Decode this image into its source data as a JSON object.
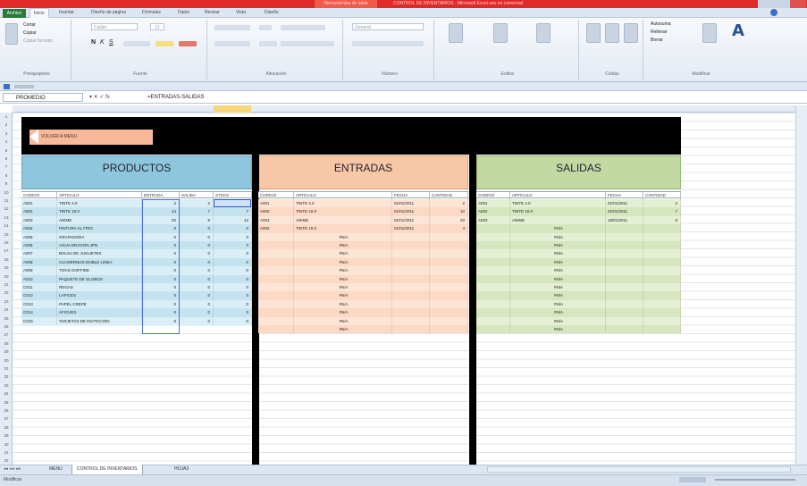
{
  "title_bar": {
    "tools_label": "Herramientas de tabla",
    "document_title": "CONTROL DE INVENTARIOS - Microsoft Excel uso no comercial"
  },
  "ribbon": {
    "tabs": [
      "Archivo",
      "Inicio",
      "Insertar",
      "Diseño de página",
      "Fórmulas",
      "Datos",
      "Revisar",
      "Vista",
      "Diseño"
    ],
    "groups": [
      "Portapapeles",
      "Fuente",
      "Alineación",
      "Número",
      "Estilos",
      "Celdas",
      "Modificar"
    ],
    "clipboard_items": [
      "Cortar",
      "Copiar",
      "Copiar formato"
    ],
    "font_name": "Calibri",
    "font_size": "11",
    "number_format": "General",
    "edit_items": [
      "Autosuma",
      "Rellenar",
      "Borrar"
    ]
  },
  "formula_bar": {
    "name_box": "PROMEDIO",
    "formula": "=ENTRADAS-SALIDAS"
  },
  "banner": {
    "back_label": "VOLVER A MENU"
  },
  "sections": {
    "productos": "PRODUCTOS",
    "entradas": "ENTRADAS",
    "salidas": "SALIDAS"
  },
  "productos": {
    "headers": [
      "CODIGO",
      "ARTICULO",
      "ENTRADA",
      "SALIDA",
      "STOCK"
    ],
    "rows": [
      [
        "A001",
        "TINTE 4.0",
        "2",
        "2",
        "=ENTRADAS-SALIDAS"
      ],
      [
        "A002",
        "TINTE 10.0",
        "14",
        "7",
        "7"
      ],
      [
        "A003",
        "ANIME",
        "20",
        "8",
        "12"
      ],
      [
        "A004",
        "PINTURA AL FRIO",
        "0",
        "0",
        "0"
      ],
      [
        "A005",
        "GRAPADORA",
        "0",
        "0",
        "0"
      ],
      [
        "A006",
        "AGUA DRAGON JPN",
        "0",
        "0",
        "0"
      ],
      [
        "A007",
        "BOLSA DE JUGUETES",
        "0",
        "0",
        "0"
      ],
      [
        "A008",
        "CUADERNOS DOBLE LINEA",
        "0",
        "0",
        "0"
      ],
      [
        "A009",
        "TIZAS GOFFIDE",
        "0",
        "0",
        "0"
      ],
      [
        "A010",
        "PAQUETE DE GLOBOS",
        "0",
        "0",
        "0"
      ],
      [
        "C011",
        "REGAS",
        "0",
        "0",
        "0"
      ],
      [
        "C012",
        "LAPICES",
        "0",
        "0",
        "0"
      ],
      [
        "C013",
        "PAPEL CREPE",
        "0",
        "0",
        "0"
      ],
      [
        "C014",
        "AFICHES",
        "0",
        "0",
        "0"
      ],
      [
        "C015",
        "TARJETAS DE INVITACION",
        "0",
        "0",
        "0"
      ]
    ]
  },
  "entradas": {
    "headers": [
      "CODIGO",
      "ARTICULO",
      "FECHA",
      "CANTIDAD"
    ],
    "rows": [
      [
        "A001",
        "TINTE 4.0",
        "01/01/2011",
        "2"
      ],
      [
        "A002",
        "TINTE 10.0",
        "01/01/2011",
        "10"
      ],
      [
        "A003",
        "ANIME",
        "01/01/2011",
        "20"
      ],
      [
        "A002",
        "TINTE 10.0",
        "01/01/2011",
        "4"
      ],
      [
        "",
        "#N/A",
        "",
        ""
      ],
      [
        "",
        "#N/A",
        "",
        ""
      ],
      [
        "",
        "#N/A",
        "",
        ""
      ],
      [
        "",
        "#N/A",
        "",
        ""
      ],
      [
        "",
        "#N/A",
        "",
        ""
      ],
      [
        "",
        "#N/A",
        "",
        ""
      ],
      [
        "",
        "#N/A",
        "",
        ""
      ],
      [
        "",
        "#N/A",
        "",
        ""
      ],
      [
        "",
        "#N/A",
        "",
        ""
      ],
      [
        "",
        "#N/A",
        "",
        ""
      ],
      [
        "",
        "#N/A",
        "",
        ""
      ],
      [
        "",
        "#N/A",
        "",
        ""
      ]
    ]
  },
  "salidas": {
    "headers": [
      "CODIGO",
      "ARTICULO",
      "FECHA",
      "CANTIDAD"
    ],
    "rows": [
      [
        "A001",
        "TINTE 4.0",
        "01/01/2011",
        "2"
      ],
      [
        "A002",
        "TINTE 10.0",
        "01/01/2011",
        "7"
      ],
      [
        "A003",
        "ANIME",
        "18/01/2011",
        "8"
      ],
      [
        "",
        "#N/A",
        "",
        ""
      ],
      [
        "",
        "#N/A",
        "",
        ""
      ],
      [
        "",
        "#N/A",
        "",
        ""
      ],
      [
        "",
        "#N/A",
        "",
        ""
      ],
      [
        "",
        "#N/A",
        "",
        ""
      ],
      [
        "",
        "#N/A",
        "",
        ""
      ],
      [
        "",
        "#N/A",
        "",
        ""
      ],
      [
        "",
        "#N/A",
        "",
        ""
      ],
      [
        "",
        "#N/A",
        "",
        ""
      ],
      [
        "",
        "#N/A",
        "",
        ""
      ],
      [
        "",
        "#N/A",
        "",
        ""
      ],
      [
        "",
        "#N/A",
        "",
        ""
      ],
      [
        "",
        "#N/A",
        "",
        ""
      ]
    ]
  },
  "sheet_tabs": [
    "MENU",
    "CONTROL DE INVENTARIOS",
    "HOJA3"
  ],
  "status": {
    "mode": "Modificar"
  },
  "colors": {
    "productos": "#8ec7dd",
    "entradas": "#f8c7a6",
    "salidas": "#c3d9a2",
    "banner": "#000000",
    "excel_green": "#2a7a3a"
  }
}
